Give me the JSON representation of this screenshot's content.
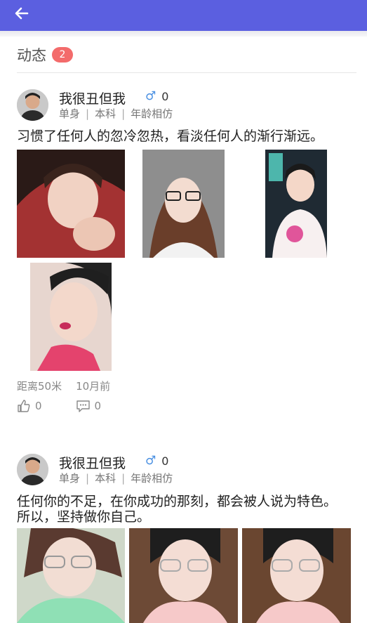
{
  "header": {
    "back_icon": "arrow-left-icon",
    "bg_color": "#5b5fe0"
  },
  "section": {
    "title": "动态",
    "badge_count": "2",
    "badge_color": "#f36b6b"
  },
  "posts": [
    {
      "username": "我很丑但我",
      "gender_symbol": "♂",
      "gender_count": "0",
      "tags": [
        "单身",
        "本科",
        "年龄相仿"
      ],
      "text": "习惯了任何人的忽冷忽热，看淡任何人的渐行渐远。",
      "photos": [
        "photo-1",
        "photo-2",
        "photo-3",
        "photo-4"
      ],
      "distance": "距离50米",
      "time": "10月前",
      "likes": "0",
      "comments": "0"
    },
    {
      "username": "我很丑但我",
      "gender_symbol": "♂",
      "gender_count": "0",
      "tags": [
        "单身",
        "本科",
        "年龄相仿"
      ],
      "text_line1": "任何你的不足，在你成功的那刻，都会被人说为特色。",
      "text_line2": "所以，坚持做你自己。",
      "photos": [
        "photo-1",
        "photo-2",
        "photo-3"
      ]
    }
  ]
}
